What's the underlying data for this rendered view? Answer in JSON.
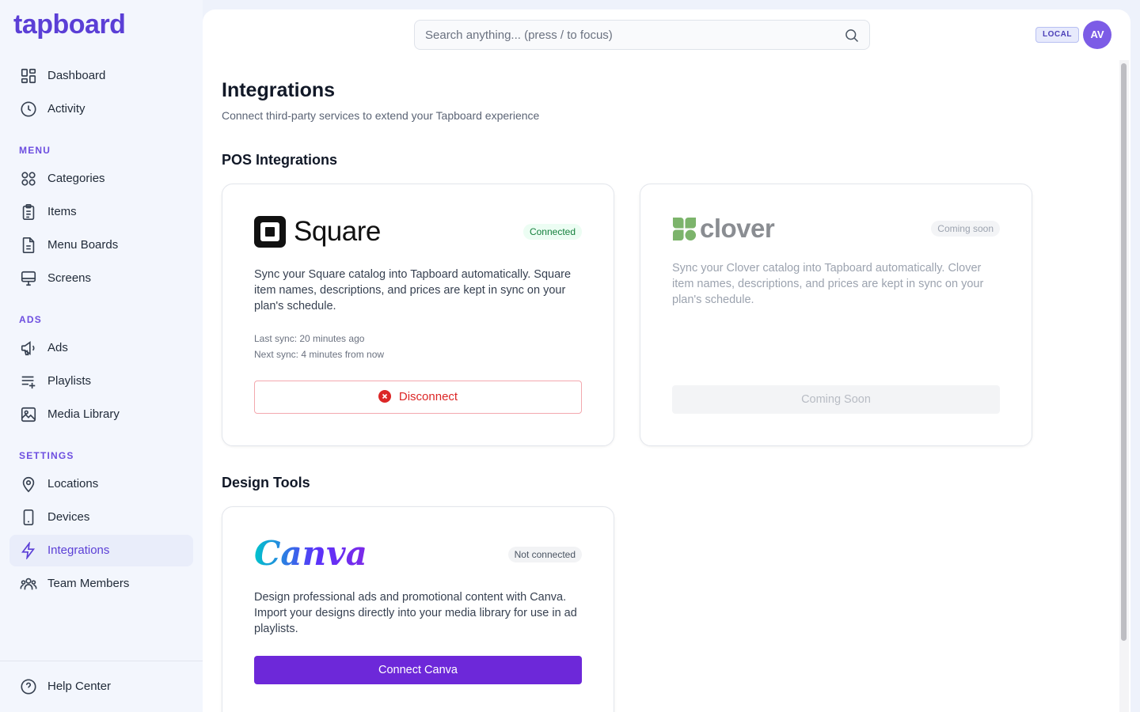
{
  "app": {
    "logo": "tapboard"
  },
  "sidebar": {
    "top_items": [
      {
        "label": "Dashboard",
        "icon": "grid-icon"
      },
      {
        "label": "Activity",
        "icon": "clock-icon"
      }
    ],
    "sections": [
      {
        "label": "MENU",
        "items": [
          {
            "label": "Categories",
            "icon": "categories-icon"
          },
          {
            "label": "Items",
            "icon": "clipboard-icon"
          },
          {
            "label": "Menu Boards",
            "icon": "document-icon"
          },
          {
            "label": "Screens",
            "icon": "monitor-icon"
          }
        ]
      },
      {
        "label": "ADS",
        "items": [
          {
            "label": "Ads",
            "icon": "megaphone-icon"
          },
          {
            "label": "Playlists",
            "icon": "playlist-icon"
          },
          {
            "label": "Media Library",
            "icon": "image-icon"
          }
        ]
      },
      {
        "label": "SETTINGS",
        "items": [
          {
            "label": "Locations",
            "icon": "location-pin-icon"
          },
          {
            "label": "Devices",
            "icon": "device-icon"
          },
          {
            "label": "Integrations",
            "icon": "lightning-icon",
            "active": true
          },
          {
            "label": "Team Members",
            "icon": "team-icon"
          }
        ]
      }
    ],
    "footer": {
      "label": "Help Center",
      "icon": "help-icon"
    }
  },
  "header": {
    "search_placeholder": "Search anything... (press / to focus)",
    "env_badge": "LOCAL",
    "avatar_initials": "AV"
  },
  "page": {
    "title": "Integrations",
    "subtitle": "Connect third-party services to extend your Tapboard experience"
  },
  "pos": {
    "heading": "POS Integrations",
    "square": {
      "name": "Square",
      "status": "Connected",
      "description": "Sync your Square catalog into Tapboard automatically. Square item names, descriptions, and prices are kept in sync on your plan's schedule.",
      "last_sync": "Last sync: 20 minutes ago",
      "next_sync": "Next sync: 4 minutes from now",
      "action": "Disconnect"
    },
    "clover": {
      "name": "clover",
      "status": "Coming soon",
      "description": "Sync your Clover catalog into Tapboard automatically. Clover item names, descriptions, and prices are kept in sync on your plan's schedule.",
      "action": "Coming Soon"
    }
  },
  "design": {
    "heading": "Design Tools",
    "canva": {
      "name": "Canva",
      "status": "Not connected",
      "description": "Design professional ads and promotional content with Canva. Import your designs directly into your media library for use in ad playlists.",
      "action": "Connect Canva"
    }
  },
  "colors": {
    "brand": "#5b3fd6",
    "connected": "#15803d",
    "danger": "#dc2626",
    "canva_button": "#6d28d9",
    "clover_green": "#7cb46b"
  }
}
